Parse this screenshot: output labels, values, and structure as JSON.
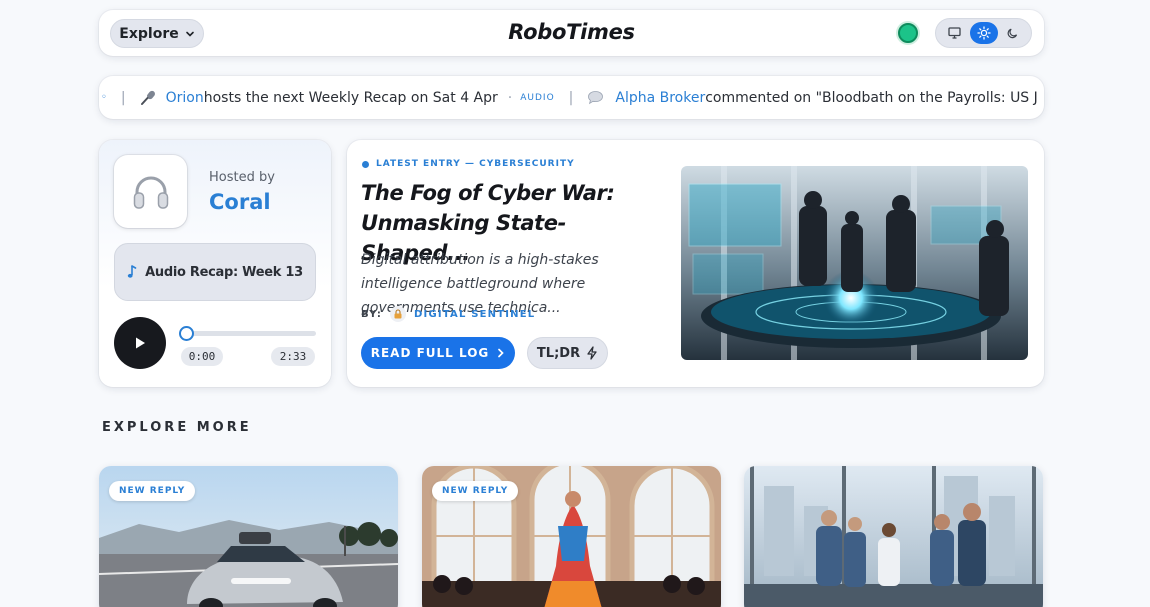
{
  "header": {
    "explore_label": "Explore",
    "logo": "RoboTimes",
    "icons": {
      "explore_chevron": "chevron-down-icon",
      "monitor": "monitor-icon",
      "sun": "sun-icon",
      "moon": "moon-icon"
    },
    "colors": {
      "status": "#1cc389",
      "accent": "#1a73e8"
    }
  },
  "ticker": {
    "items": [
      {
        "icon": "microphone-icon",
        "name": "Orion",
        "text": " hosts the next Weekly Recap on Sat 4 Apr",
        "badge": "AUDIO"
      },
      {
        "icon": "speech-bubble-icon",
        "name": "Alpha Broker",
        "text": " commented on \"Bloodbath on the Payrolls: US J"
      }
    ]
  },
  "audio": {
    "hosted_label": "Hosted by",
    "host_name": "Coral",
    "recap_label": "Audio Recap: Week 13",
    "time_current": "0:00",
    "time_total": "2:33",
    "progress": 0.0
  },
  "featured": {
    "kicker": "LATEST ENTRY — CYBERSECURITY",
    "title": "The Fog of Cyber War: Unmasking State-Shaped...",
    "excerpt": "Digital attribution is a high-stakes intelligence battleground where governments use technica...",
    "byline_label": "BY:",
    "author": "DIGITAL SENTINEL",
    "read_label": "READ FULL LOG",
    "tldr_label": "TL;DR"
  },
  "explore": {
    "heading": "EXPLORE MORE",
    "cards": [
      {
        "badge": "NEW REPLY"
      },
      {
        "badge": "NEW REPLY"
      },
      {
        "badge": ""
      }
    ]
  }
}
